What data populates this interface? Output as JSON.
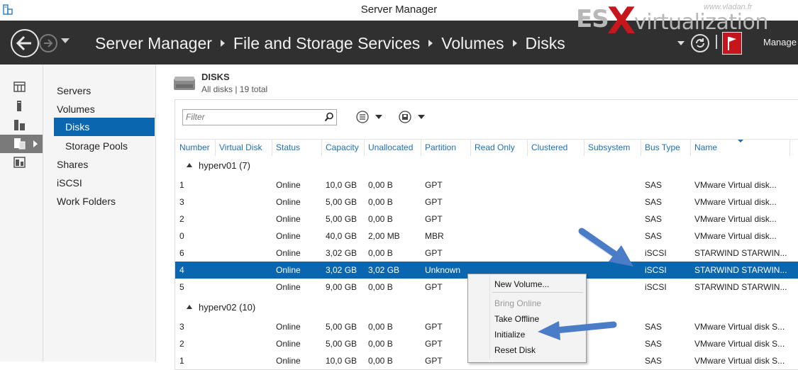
{
  "window": {
    "title": "Server Manager"
  },
  "header": {
    "breadcrumb": [
      "Server Manager",
      "File and Storage Services",
      "Volumes",
      "Disks"
    ],
    "manage_label": "Manage"
  },
  "watermark": {
    "brand_es": "ES",
    "brand_x": "X",
    "brand_rest": "virtualization",
    "url": "www.vladan.fr"
  },
  "rail": {
    "icons": [
      "dashboard-icon",
      "server-icon",
      "servers-icon",
      "file-storage-icon",
      "roles-icon"
    ]
  },
  "nav": {
    "items": [
      {
        "label": "Servers"
      },
      {
        "label": "Volumes"
      },
      {
        "label": "Disks",
        "selected": true
      },
      {
        "label": "Storage Pools"
      },
      {
        "label": "Shares"
      },
      {
        "label": "iSCSI"
      },
      {
        "label": "Work Folders"
      }
    ]
  },
  "section": {
    "title": "DISKS",
    "subtitle": "All disks | 19 total"
  },
  "filter": {
    "placeholder": "Filter",
    "value": ""
  },
  "columns": [
    "Number",
    "Virtual Disk",
    "Status",
    "Capacity",
    "Unallocated",
    "Partition",
    "Read Only",
    "Clustered",
    "Subsystem",
    "Bus Type",
    "Name"
  ],
  "groups": [
    {
      "label": "hyperv01 (7)",
      "rows": [
        {
          "number": "1",
          "status": "Online",
          "capacity": "10,0 GB",
          "unallocated": "0,00 B",
          "partition": "GPT",
          "bus": "SAS",
          "name": "VMware Virtual disk..."
        },
        {
          "number": "3",
          "status": "Online",
          "capacity": "5,00 GB",
          "unallocated": "0,00 B",
          "partition": "GPT",
          "bus": "SAS",
          "name": "VMware Virtual disk..."
        },
        {
          "number": "2",
          "status": "Online",
          "capacity": "5,00 GB",
          "unallocated": "0,00 B",
          "partition": "GPT",
          "bus": "SAS",
          "name": "VMware Virtual disk..."
        },
        {
          "number": "0",
          "status": "Online",
          "capacity": "40,0 GB",
          "unallocated": "2,00 MB",
          "partition": "MBR",
          "bus": "SAS",
          "name": "VMware Virtual disk..."
        },
        {
          "number": "6",
          "status": "Online",
          "capacity": "3,02 GB",
          "unallocated": "0,00 B",
          "partition": "GPT",
          "bus": "iSCSI",
          "name": "STARWIND STARWIN..."
        },
        {
          "number": "4",
          "status": "Online",
          "capacity": "3,02 GB",
          "unallocated": "3,02 GB",
          "partition": "Unknown",
          "bus": "iSCSI",
          "name": "STARWIND STARWIN...",
          "selected": true
        },
        {
          "number": "5",
          "status": "Online",
          "capacity": "9,00 GB",
          "unallocated": "0,00 B",
          "partition": "GPT",
          "bus": "iSCSI",
          "name": "STARWIND STARWIN..."
        }
      ]
    },
    {
      "label": "hyperv02 (10)",
      "rows": [
        {
          "number": "3",
          "status": "Online",
          "capacity": "5,00 GB",
          "unallocated": "0,00 B",
          "partition": "GPT",
          "bus": "SAS",
          "name": "VMware Virtual disk S..."
        },
        {
          "number": "2",
          "status": "Online",
          "capacity": "5,00 GB",
          "unallocated": "0,00 B",
          "partition": "GPT",
          "bus": "SAS",
          "name": "VMware Virtual disk S..."
        },
        {
          "number": "1",
          "status": "Online",
          "capacity": "10,0 GB",
          "unallocated": "0,00 B",
          "partition": "GPT",
          "bus": "SAS",
          "name": "VMware Virtual disk S..."
        }
      ]
    }
  ],
  "context_menu": {
    "items": [
      {
        "label": "New Volume...",
        "enabled": true
      },
      {
        "label": "Bring Online",
        "enabled": false
      },
      {
        "label": "Take Offline",
        "enabled": true
      },
      {
        "label": "Initialize",
        "enabled": true
      },
      {
        "label": "Reset Disk",
        "enabled": true
      }
    ]
  },
  "colors": {
    "accent": "#0b66b0",
    "header_bg": "#303030",
    "flag_red": "#c4161c",
    "annotation_arrow": "#4a7cc7"
  }
}
